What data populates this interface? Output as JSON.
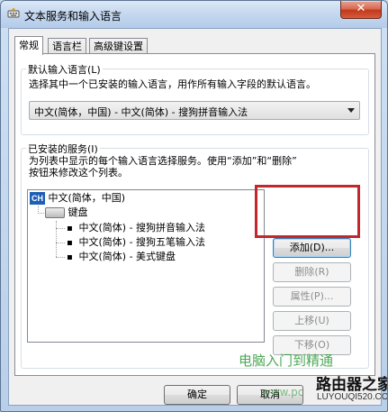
{
  "window": {
    "title": "文本服务和输入语言",
    "close_symbol": "✕"
  },
  "tabs": [
    {
      "label": "常规",
      "active": true
    },
    {
      "label": "语言栏",
      "active": false
    },
    {
      "label": "高级键设置",
      "active": false
    }
  ],
  "default_language": {
    "legend": "默认输入语言(L)",
    "description": "选择其中一个已安装的输入语言，用作所有输入字段的默认语言。",
    "selected": "中文(简体，中国) - 中文(简体) - 搜狗拼音输入法"
  },
  "installed_services": {
    "legend": "已安装的服务(I)",
    "description_line1": "为列表中显示的每个输入语言选择服务。使用“添加”和“删除”",
    "description_line2": "按钮来修改这个列表。",
    "tree": {
      "language_badge": "CH",
      "language": "中文(简体，中国)",
      "category": "键盘",
      "bullet": "▪",
      "items": [
        "中文(简体) - 搜狗拼音输入法",
        "中文(简体) - 搜狗五笔输入法",
        "中文(简体) - 美式键盘"
      ]
    },
    "buttons": {
      "add": "添加(D)...",
      "remove": "删除(R)",
      "properties": "属性(P)...",
      "move_up": "上移(U)",
      "move_down": "下移(O)"
    }
  },
  "footer": {
    "ok": "确定",
    "cancel": "取消"
  },
  "watermark": {
    "text1": "电脑入门到精通",
    "brand": "路由器之家",
    "site": "LUYOUQI520.COM",
    "text2": "www.pc"
  },
  "colors": {
    "highlight": "#c1272d",
    "ch_badge": "#1e5fb4"
  }
}
